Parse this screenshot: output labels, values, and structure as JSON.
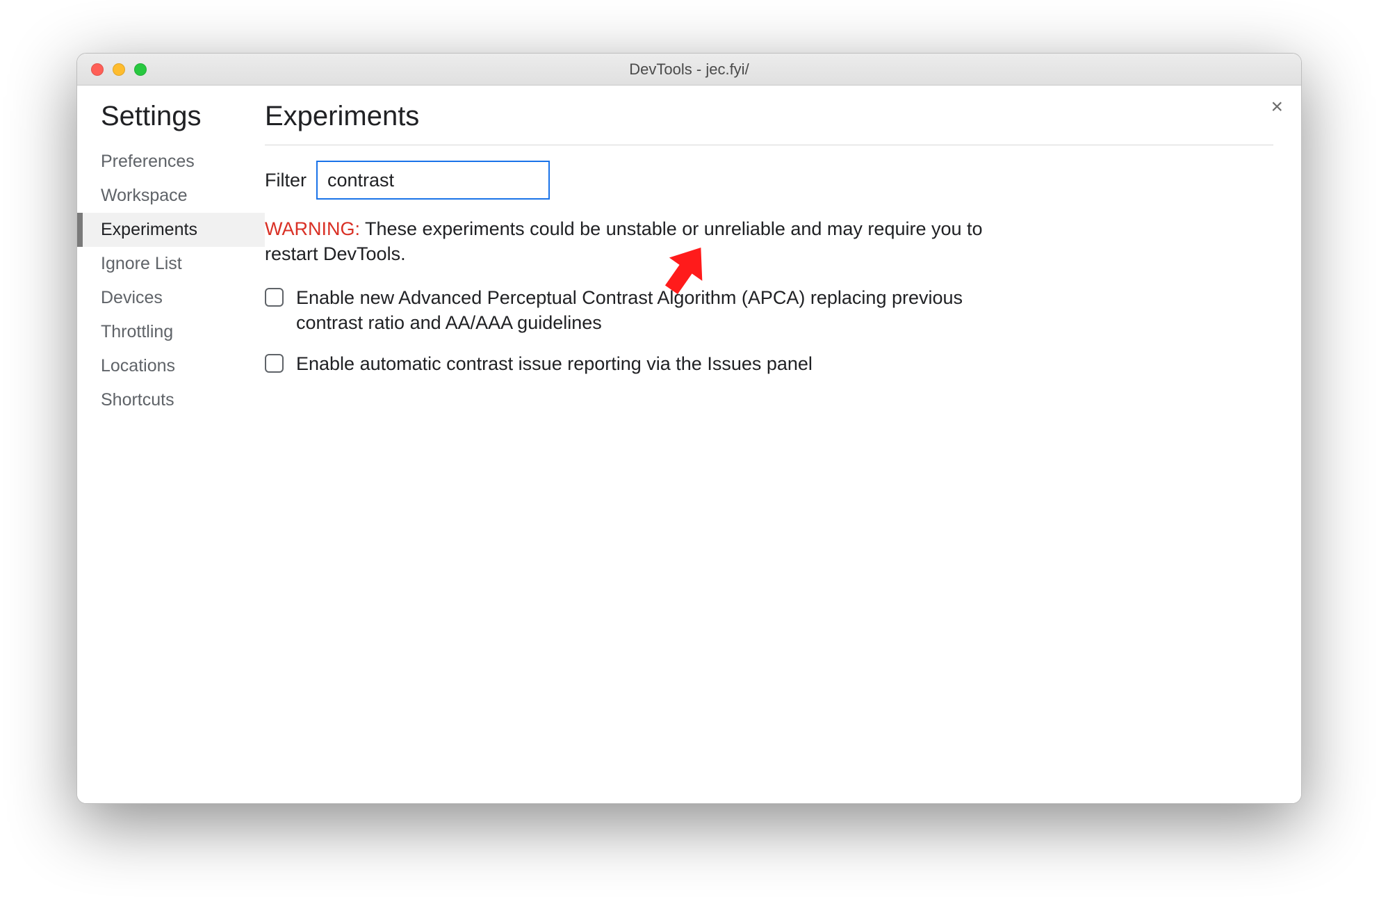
{
  "window": {
    "title": "DevTools - jec.fyi/"
  },
  "sidebar": {
    "heading": "Settings",
    "items": [
      {
        "label": "Preferences"
      },
      {
        "label": "Workspace"
      },
      {
        "label": "Experiments"
      },
      {
        "label": "Ignore List"
      },
      {
        "label": "Devices"
      },
      {
        "label": "Throttling"
      },
      {
        "label": "Locations"
      },
      {
        "label": "Shortcuts"
      }
    ],
    "active_index": 2
  },
  "main": {
    "heading": "Experiments",
    "filter_label": "Filter",
    "filter_value": "contrast",
    "warning_prefix": "WARNING:",
    "warning_text": " These experiments could be unstable or unreliable and may require you to restart DevTools.",
    "experiments": [
      {
        "label": "Enable new Advanced Perceptual Contrast Algorithm (APCA) replacing previous contrast ratio and AA/AAA guidelines",
        "checked": false
      },
      {
        "label": "Enable automatic contrast issue reporting via the Issues panel",
        "checked": false
      }
    ]
  },
  "close_label": "×"
}
